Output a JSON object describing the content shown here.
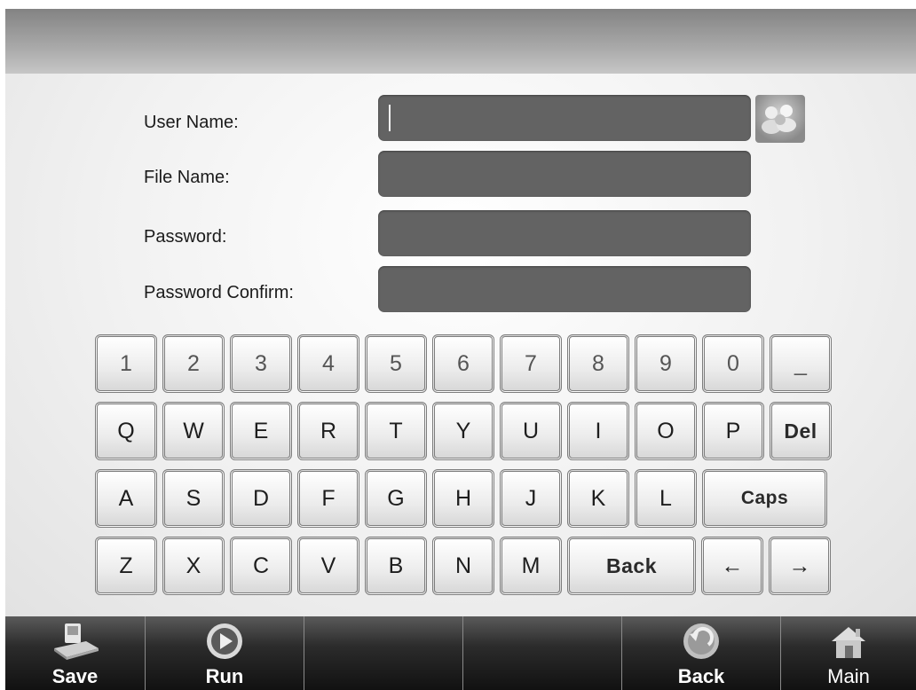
{
  "form": {
    "fields": [
      {
        "label": "User Name:",
        "value": ""
      },
      {
        "label": "File Name:",
        "value": ""
      },
      {
        "label": "Password:",
        "value": ""
      },
      {
        "label": "Password Confirm:",
        "value": ""
      }
    ]
  },
  "keyboard": {
    "row1": [
      "1",
      "2",
      "3",
      "4",
      "5",
      "6",
      "7",
      "8",
      "9",
      "0",
      "_"
    ],
    "row2": [
      "Q",
      "W",
      "E",
      "R",
      "T",
      "Y",
      "U",
      "I",
      "O",
      "P",
      "Del"
    ],
    "row3": [
      "A",
      "S",
      "D",
      "F",
      "G",
      "H",
      "J",
      "K",
      "L",
      "Caps"
    ],
    "row4": [
      "Z",
      "X",
      "C",
      "V",
      "B",
      "N",
      "M",
      "Back",
      "←",
      "→"
    ]
  },
  "toolbar": {
    "save": "Save",
    "run": "Run",
    "back": "Back",
    "main": "Main"
  }
}
